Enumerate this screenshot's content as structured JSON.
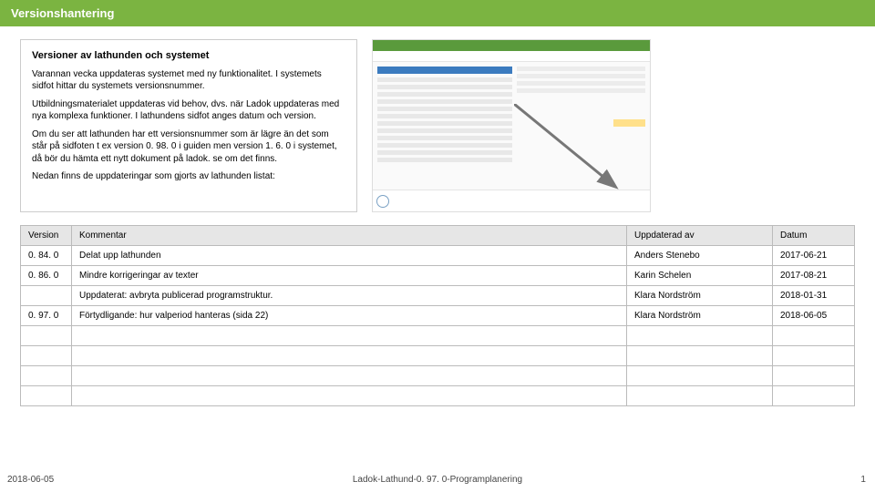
{
  "header": {
    "title": "Versionshantering"
  },
  "intro": {
    "heading": "Versioner av lathunden och systemet",
    "p1": "Varannan vecka uppdateras systemet med ny funktionalitet. I systemets sidfot hittar du systemets versionsnummer.",
    "p2": "Utbildningsmaterialet uppdateras vid behov, dvs. när Ladok uppdateras med nya komplexa funktioner. I lathundens sidfot anges datum och version.",
    "p3": "Om du ser att lathunden har ett versionsnummer som är lägre än det som står på sidfoten t ex version 0. 98. 0 i guiden men version 1. 6. 0 i systemet, då bör du hämta ett nytt dokument på ladok. se om det finns.",
    "p4": "Nedan finns de uppdateringar som gjorts av lathunden listat:"
  },
  "table": {
    "headers": {
      "version": "Version",
      "comment": "Kommentar",
      "updated_by": "Uppdaterad av",
      "date": "Datum"
    },
    "rows": [
      {
        "version": "0. 84. 0",
        "comment": "Delat upp lathunden",
        "updated_by": "Anders Stenebo",
        "date": "2017-06-21"
      },
      {
        "version": "0. 86. 0",
        "comment": "Mindre korrigeringar av texter",
        "updated_by": "Karin Schelen",
        "date": "2017-08-21"
      },
      {
        "version": "",
        "comment": "Uppdaterat: avbryta publicerad programstruktur.",
        "updated_by": "Klara Nordström",
        "date": "2018-01-31"
      },
      {
        "version": "0. 97. 0",
        "comment": "Förtydligande: hur valperiod hanteras (sida 22)",
        "updated_by": "Klara Nordström",
        "date": "2018-06-05"
      },
      {
        "version": "",
        "comment": "",
        "updated_by": "",
        "date": ""
      },
      {
        "version": "",
        "comment": "",
        "updated_by": "",
        "date": ""
      },
      {
        "version": "",
        "comment": "",
        "updated_by": "",
        "date": ""
      },
      {
        "version": "",
        "comment": "",
        "updated_by": "",
        "date": ""
      }
    ]
  },
  "footer": {
    "date": "2018-06-05",
    "center": "Ladok-Lathund-0. 97. 0-Programplanering",
    "page": "1"
  }
}
